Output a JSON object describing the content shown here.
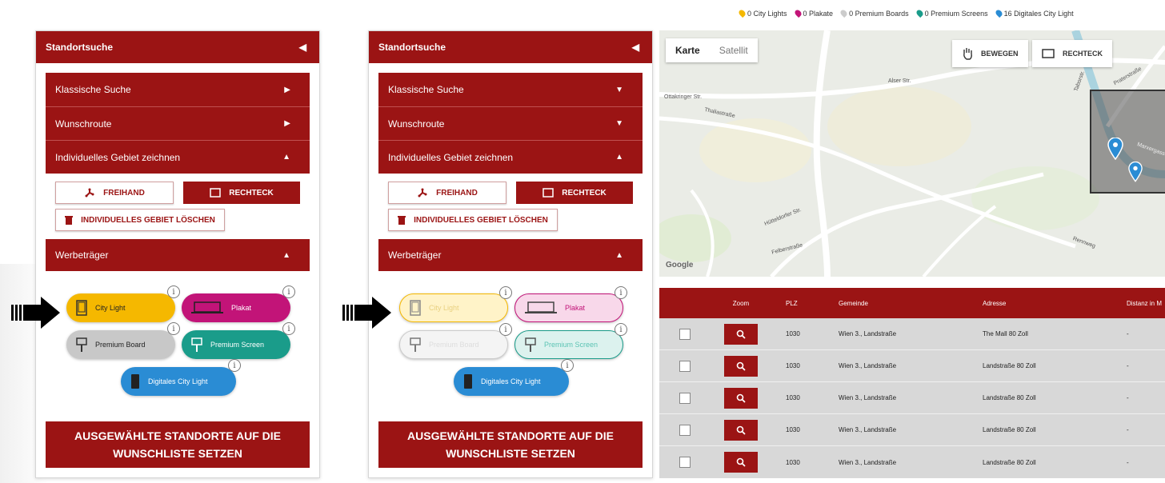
{
  "legend": [
    {
      "label": "0 City Lights",
      "color": "#f5b800"
    },
    {
      "label": "0 Plakate",
      "color": "#c21478"
    },
    {
      "label": "0 Premium Boards",
      "color": "#cccccc"
    },
    {
      "label": "0 Premium Screens",
      "color": "#1a9c8a"
    },
    {
      "label": "16 Digitales City Light",
      "color": "#2a8cd4"
    }
  ],
  "panels": [
    {
      "title": "Standortsuche",
      "accordion": [
        "Klassische Suche",
        "Wunschroute",
        "Individuelles Gebiet zeichnen"
      ],
      "freihand": "FREIHAND",
      "rechteck": "RECHTECK",
      "delete": "INDIVIDUELLES GEBIET LÖSCHEN",
      "werbetraeger": "Werbeträger",
      "pills": [
        "City Light",
        "Plakat",
        "Premium Board",
        "Premium Screen",
        "Digitales City Light"
      ],
      "submit": "AUSGEWÄHLTE STANDORTE AUF DIE WUNSCHLISTE SETZEN"
    },
    {
      "title": "Standortsuche",
      "accordion": [
        "Klassische Suche",
        "Wunschroute",
        "Individuelles Gebiet zeichnen"
      ],
      "freihand": "FREIHAND",
      "rechteck": "RECHTECK",
      "delete": "INDIVIDUELLES GEBIET LÖSCHEN",
      "werbetraeger": "Werbeträger",
      "pills": [
        "City Light",
        "Plakat",
        "Premium Board",
        "Premium Screen",
        "Digitales City Light"
      ],
      "submit": "AUSGEWÄHLTE STANDORTE AUF DIE WUNSCHLISTE SETZEN"
    }
  ],
  "map": {
    "tab_karte": "Karte",
    "tab_satellit": "Satellit",
    "bewegen": "BEWEGEN",
    "rechteck": "RECHTECK",
    "labels": [
      "Ottakringer Str.",
      "Thaliastraße",
      "Alser Str.",
      "Hütteldorfer Str.",
      "Felberstraße",
      "Praterstraße",
      "Taborstr.",
      "Rennweg",
      "Marxergasse"
    ],
    "google": "Google"
  },
  "table": {
    "headers": [
      "Zoom",
      "PLZ",
      "Gemeinde",
      "Adresse",
      "Distanz in M"
    ],
    "rows": [
      {
        "plz": "1030",
        "gemeinde": "Wien 3., Landstraße",
        "adresse": "The Mall 80 Zoll",
        "distanz": "-"
      },
      {
        "plz": "1030",
        "gemeinde": "Wien 3., Landstraße",
        "adresse": "Landstraße 80 Zoll",
        "distanz": "-"
      },
      {
        "plz": "1030",
        "gemeinde": "Wien 3., Landstraße",
        "adresse": "Landstraße 80 Zoll",
        "distanz": "-"
      },
      {
        "plz": "1030",
        "gemeinde": "Wien 3., Landstraße",
        "adresse": "Landstraße 80 Zoll",
        "distanz": "-"
      },
      {
        "plz": "1030",
        "gemeinde": "Wien 3., Landstraße",
        "adresse": "Landstraße 80 Zoll",
        "distanz": "-"
      }
    ]
  },
  "colors": {
    "brand_red": "#9b1414",
    "city_light": "#f5b800",
    "plakat": "#c21478",
    "premium_board": "#c8c8c8",
    "premium_screen": "#1a9c8a",
    "digital": "#2a8cd4"
  }
}
